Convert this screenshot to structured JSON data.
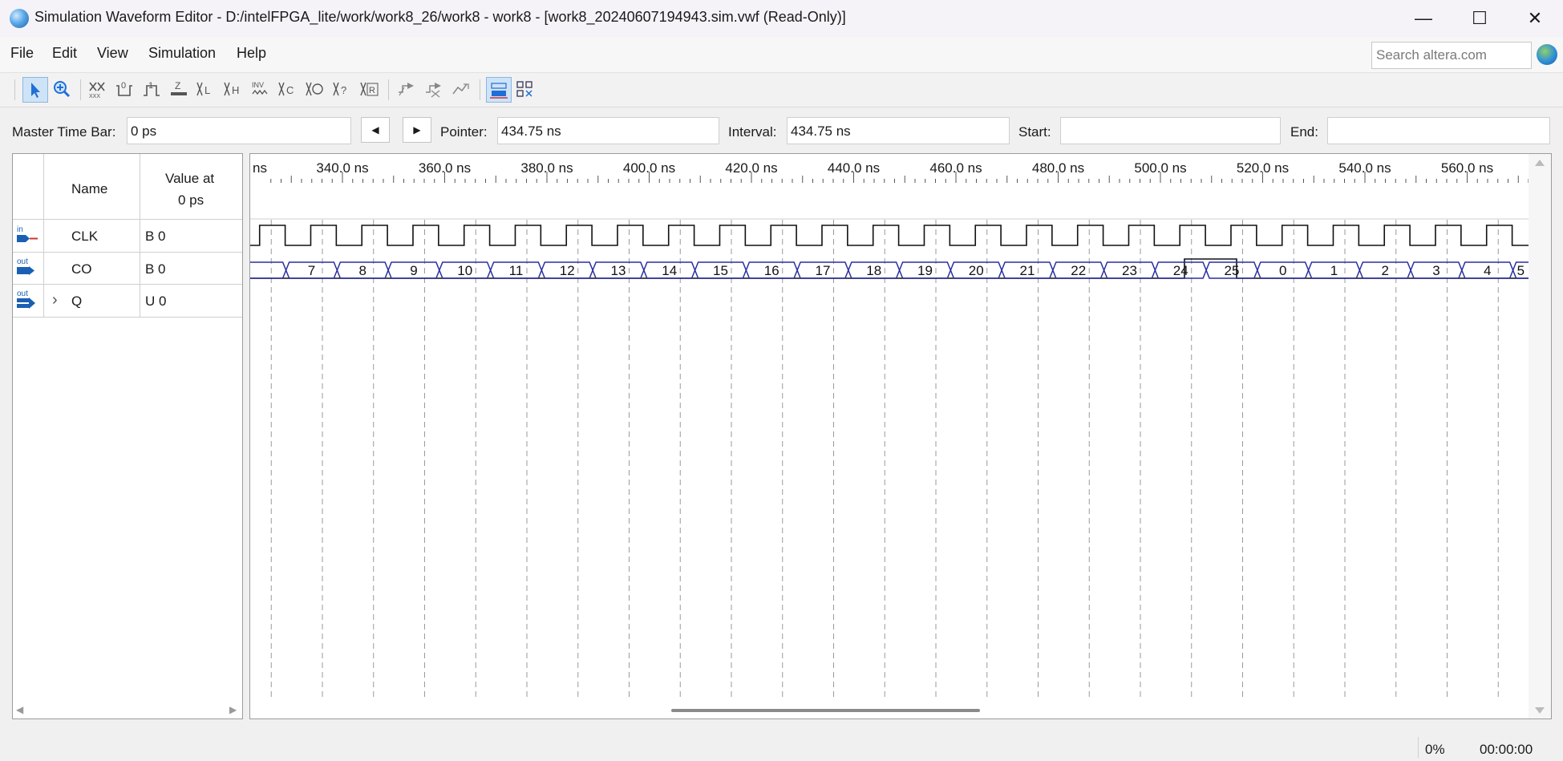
{
  "window": {
    "title": "Simulation Waveform Editor - D:/intelFPGA_lite/work/work8_26/work8 - work8 - [work8_20240607194943.sim.vwf (Read-Only)]",
    "minimize_glyph": "—",
    "maximize_glyph": "☐",
    "close_glyph": "✕"
  },
  "menu": {
    "items": [
      {
        "label": "File"
      },
      {
        "label": "Edit"
      },
      {
        "label": "View"
      },
      {
        "label": "Simulation"
      },
      {
        "label": "Help"
      }
    ],
    "search_placeholder": "Search altera.com"
  },
  "toolbar": {
    "icons": [
      "selection-tool-icon",
      "zoom-tool-icon",
      "forcing-unknown-icon",
      "forcing-low-icon",
      "forcing-high-icon",
      "high-impedance-icon",
      "weak-low-icon",
      "weak-high-icon",
      "invert-icon",
      "count-value-icon",
      "overwrite-clock-icon",
      "random-values-icon",
      "dont-care-icon",
      "snap-to-grid-icon",
      "arbitrary-value-icon",
      "group-icon",
      "ungroup-icon",
      "bus-icon",
      "hierarchy-icon"
    ]
  },
  "timebar": {
    "master_label": "Master Time Bar:",
    "master_value": "0 ps",
    "pointer_label": "Pointer:",
    "pointer_value": "434.75 ns",
    "interval_label": "Interval:",
    "interval_value": "434.75 ns",
    "start_label": "Start:",
    "start_value": "",
    "end_label": "End:",
    "end_value": ""
  },
  "signals": {
    "header_name": "Name",
    "header_value_line1": "Value at",
    "header_value_line2": "0 ps",
    "expand_glyph": "›",
    "rows": [
      {
        "dir": "in",
        "name": "CLK",
        "value": "B 0"
      },
      {
        "dir": "out",
        "name": "CO",
        "value": "B 0"
      },
      {
        "dir": "out",
        "name": "Q",
        "value": "U 0"
      }
    ]
  },
  "waveform": {
    "time_labels": [
      "ns",
      "340.0 ns",
      "360.0 ns",
      "380.0 ns",
      "400.0 ns",
      "420.0 ns",
      "440.0 ns",
      "460.0 ns",
      "480.0 ns",
      "500.0 ns",
      "520.0 ns",
      "540.0 ns",
      "560.0 ns"
    ],
    "q_values": [
      "7",
      "8",
      "9",
      "10",
      "11",
      "12",
      "13",
      "14",
      "15",
      "16",
      "17",
      "18",
      "19",
      "20",
      "21",
      "22",
      "23",
      "24",
      "25",
      "0",
      "1",
      "2",
      "3",
      "4",
      "5"
    ],
    "co_high_label": "25",
    "clock_period_ns": 10,
    "wave_color": "#2a2fa0"
  },
  "status": {
    "progress": "0%",
    "elapsed": "00:00:00"
  }
}
